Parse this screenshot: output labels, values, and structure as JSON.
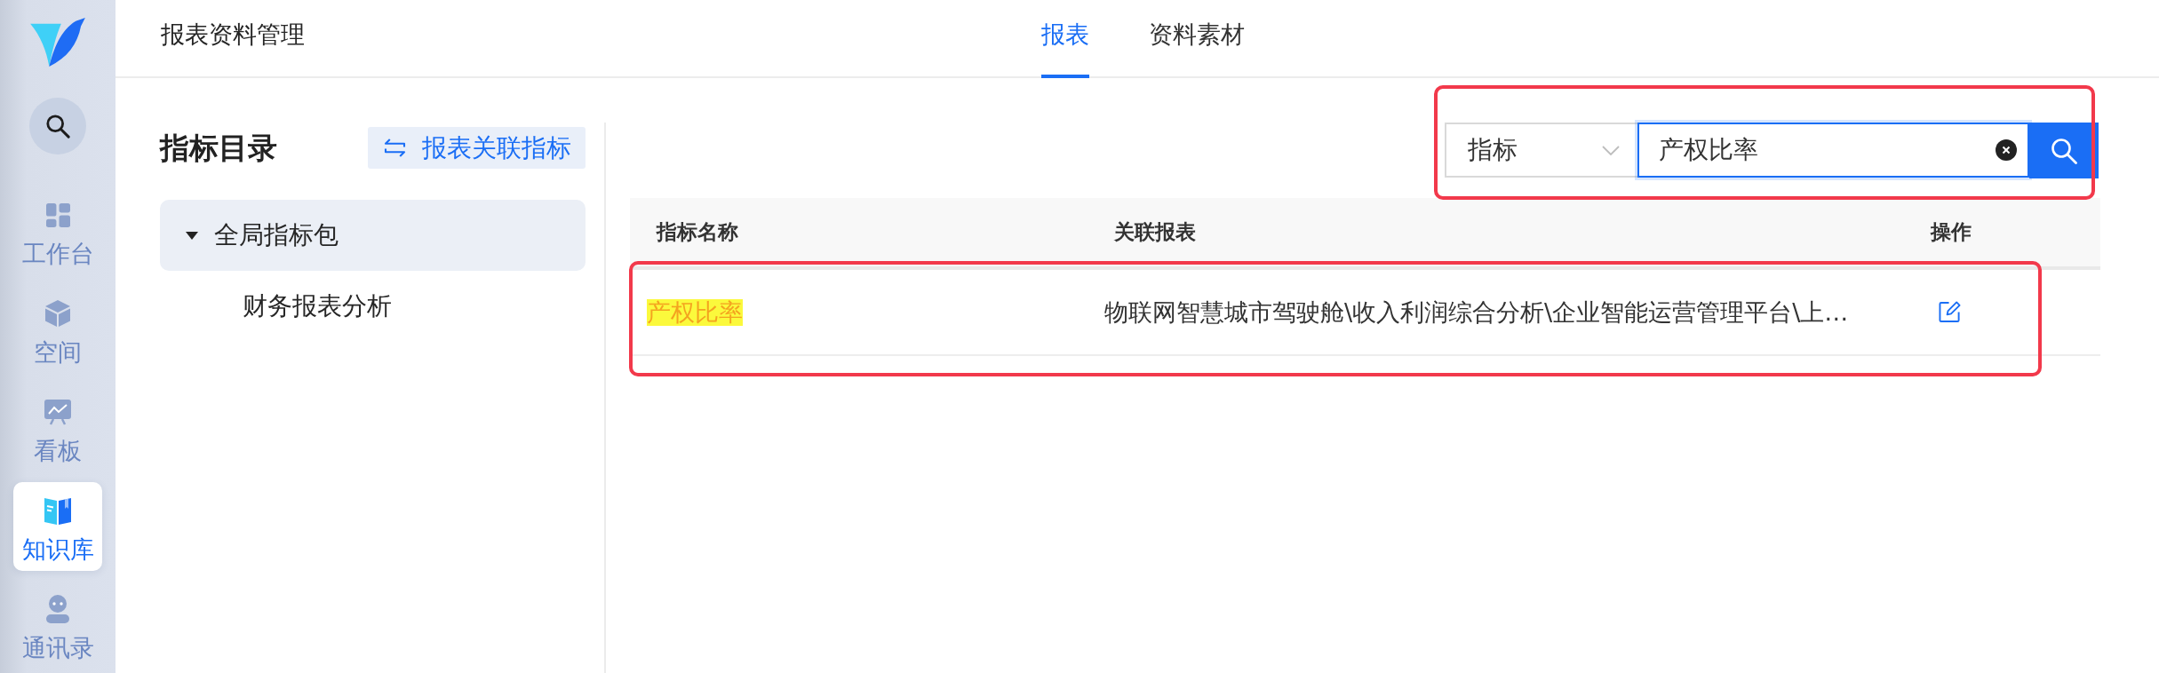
{
  "app_sidebar": {
    "items": [
      {
        "label": "工作台",
        "selected": false
      },
      {
        "label": "空间",
        "selected": false
      },
      {
        "label": "看板",
        "selected": false
      },
      {
        "label": "知识库",
        "selected": true
      },
      {
        "label": "通讯录",
        "selected": false
      }
    ]
  },
  "header": {
    "title": "报表资料管理",
    "tabs": [
      {
        "label": "报表",
        "selected": true
      },
      {
        "label": "资料素材",
        "selected": false
      }
    ]
  },
  "catalog": {
    "title": "指标目录",
    "action_button": "报表关联指标",
    "tree": [
      {
        "label": "全局指标包",
        "selected": true,
        "expanded": true,
        "children": [
          {
            "label": "财务报表分析",
            "selected": false
          }
        ]
      }
    ]
  },
  "search": {
    "scope": "指标",
    "value": "产权比率",
    "annotated": true
  },
  "table": {
    "columns": [
      "指标名称",
      "关联报表",
      "操作"
    ],
    "rows": [
      {
        "name": "产权比率",
        "name_highlighted": true,
        "reports": "物联网智慧城市驾驶舱\\收入利润综合分析\\企业智能运营管理平台\\上…",
        "annotated": true
      }
    ]
  }
}
